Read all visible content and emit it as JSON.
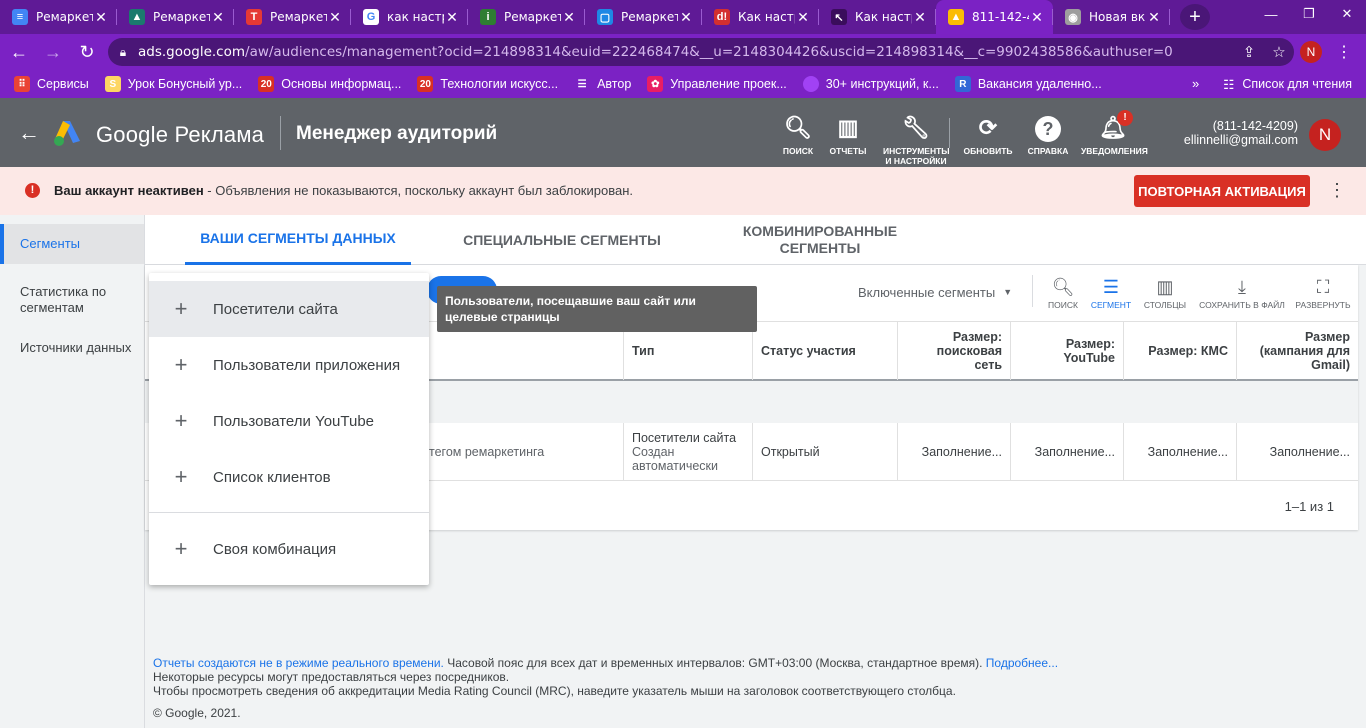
{
  "browser": {
    "tabs": [
      {
        "title": "Ремаркет",
        "icon": "docs-icon",
        "color": "#4285f4",
        "glyph": "≡",
        "active": false
      },
      {
        "title": "Ремаркет",
        "icon": "triangle-logo-icon",
        "color": "#1b7a6e",
        "glyph": "▲",
        "active": false
      },
      {
        "title": "Ремаркет",
        "icon": "t-logo-icon",
        "color": "#e53935",
        "glyph": "T",
        "active": false
      },
      {
        "title": "как настр",
        "icon": "google-icon",
        "color": "#ffffff",
        "glyph": "G",
        "active": false
      },
      {
        "title": "Ремаркет",
        "icon": "info-icon",
        "color": "#2e7d32",
        "glyph": "i",
        "active": false
      },
      {
        "title": "Ремаркет",
        "icon": "square-logo-icon",
        "color": "#1e88e5",
        "glyph": "▢",
        "active": false
      },
      {
        "title": "Как настр",
        "icon": "d-logo-icon",
        "color": "#d32f2f",
        "glyph": "d!",
        "active": false
      },
      {
        "title": "Как настр",
        "icon": "cursor-logo-icon",
        "color": "#3a0d5c",
        "glyph": "↖",
        "active": false
      },
      {
        "title": "811-142-4",
        "icon": "google-ads-icon",
        "color": "#fbbc04",
        "glyph": "▲",
        "active": true
      },
      {
        "title": "Новая вк",
        "icon": "chrome-icon",
        "color": "#9e9e9e",
        "glyph": "◉",
        "active": false
      }
    ],
    "url_host": "ads.google.com",
    "url_path": "/aw/audiences/management?ocid=214898314&euid=222468474&__u=2148304426&uscid=214898314&__c=9902438586&authuser=0",
    "profile_initial": "N"
  },
  "bookmarks": {
    "items": [
      {
        "label": "Сервисы",
        "icon": "apps-grid-icon",
        "color": "#ea4335",
        "glyph": "⠿"
      },
      {
        "label": "Урок Бонусный ур...",
        "icon": "bonus-lesson-icon",
        "color": "#fdd663",
        "glyph": "S"
      },
      {
        "label": "Основы информац...",
        "icon": "calendar-bookmark-icon",
        "color": "#d93025",
        "glyph": "20"
      },
      {
        "label": "Технологии искусс...",
        "icon": "calendar-bookmark-icon",
        "color": "#d93025",
        "glyph": "20"
      },
      {
        "label": "Автор",
        "icon": "list-icon",
        "color": "#7b22c4",
        "glyph": "☰"
      },
      {
        "label": "Управление проек...",
        "icon": "colorful-logo-icon",
        "color": "#e91e63",
        "glyph": "✿"
      },
      {
        "label": "30+ инструкций, к...",
        "icon": "purple-circle-icon",
        "color": "#a142f4",
        "glyph": ""
      },
      {
        "label": "Вакансия удаленно...",
        "icon": "r-logo-icon",
        "color": "#3367d6",
        "glyph": "R"
      }
    ],
    "reading_list": "Список для чтения"
  },
  "ads_header": {
    "brand": "Google Реклама",
    "page_title": "Менеджер аудиторий",
    "buttons": [
      {
        "label": "ПОИСК",
        "icon": "search-icon",
        "glyph": "🔍︎"
      },
      {
        "label": "ОТЧЕТЫ",
        "icon": "reports-icon",
        "glyph": "▥"
      },
      {
        "label": "ИНСТРУМЕНТЫ И НАСТРОЙКИ",
        "icon": "wrench-icon",
        "glyph": "🔧︎"
      },
      {
        "label": "ОБНОВИТЬ",
        "icon": "refresh-icon",
        "glyph": "⟳"
      },
      {
        "label": "СПРАВКА",
        "icon": "help-icon",
        "glyph": "?"
      },
      {
        "label": "УВЕДОМЛЕНИЯ",
        "icon": "bell-icon",
        "glyph": "🔔︎"
      }
    ],
    "notification_badge": "!",
    "account_id": "(811-142-4209)",
    "account_email": "ellinnelli@gmail.com",
    "avatar_initial": "N"
  },
  "alert": {
    "bold": "Ваш аккаунт неактивен",
    "text": " - Объявления не показываются, поскольку аккаунт был заблокирован.",
    "button": "ПОВТОРНАЯ АКТИВАЦИЯ",
    "color": "#d93025"
  },
  "leftnav": {
    "items": [
      "Сегменты",
      "Статистика по сегментам",
      "Источники данных"
    ]
  },
  "segment_tabs": [
    "ВАШИ СЕГМЕНТЫ ДАННЫХ",
    "СПЕЦИАЛЬНЫЕ СЕГМЕНТЫ",
    "КОМБИНИРОВАННЫЕ СЕГМЕНТЫ"
  ],
  "table_tools": {
    "filter": "Включенные сегменты",
    "buttons": [
      {
        "label": "ПОИСК",
        "icon": "search-icon",
        "glyph": "🔍︎"
      },
      {
        "label": "СЕГМЕНТ",
        "icon": "segment-icon",
        "glyph": "☰"
      },
      {
        "label": "СТОЛБЦЫ",
        "icon": "columns-icon",
        "glyph": "▥"
      },
      {
        "label": "СОХРАНИТЬ В ФАЙЛ",
        "icon": "download-icon",
        "glyph": "⤓"
      },
      {
        "label": "РАЗВЕРНУТЬ",
        "icon": "fullscreen-icon",
        "glyph": "⛶"
      }
    ]
  },
  "table": {
    "headers": [
      "Тип",
      "Статус участия",
      "Размер: поисковая сеть",
      "Размер: YouTube",
      "Размер: КМС",
      "Размер (кампания для Gmail)"
    ],
    "row": {
      "name_fragment": "тегом ремаркетинга",
      "type": "Посетители сайта",
      "type_sub": "Создан автоматически",
      "status": "Открытый",
      "size_search": "Заполнение...",
      "size_youtube": "Заполнение...",
      "size_kms": "Заполнение...",
      "size_gmail": "Заполнение..."
    },
    "pager": "1–1 из 1"
  },
  "menu": {
    "items": [
      "Посетители сайта",
      "Пользователи приложения",
      "Пользователи YouTube",
      "Список клиентов",
      "Своя комбинация"
    ]
  },
  "tooltip": "Пользователи, посещавшие ваш сайт или целевые страницы",
  "footer": {
    "link1": "Отчеты создаются не в режиме реального времени.",
    "line1": " Часовой пояс для всех дат и временных интервалов: GMT+03:00 (Москва, стандартное время).",
    "link2": "Подробнее...",
    "line2": "Некоторые ресурсы могут предоставляться через посредников.",
    "line3": "Чтобы просмотреть сведения об аккредитации Media Rating Council (MRC), наведите указатель мыши на заголовок соответствующего столбца.",
    "copyright": "© Google, 2021."
  }
}
